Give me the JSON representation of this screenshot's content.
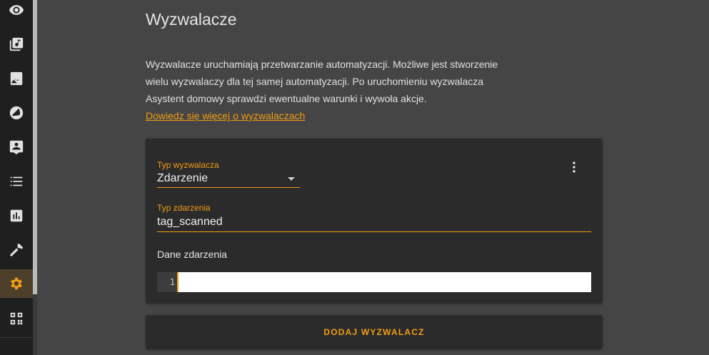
{
  "sidebar": {
    "items": [
      {
        "icon": "eye-icon",
        "active": false
      },
      {
        "icon": "media-library-icon",
        "active": false
      },
      {
        "icon": "image-search-icon",
        "active": false
      },
      {
        "icon": "no-entry-icon",
        "active": false
      },
      {
        "icon": "account-message-icon",
        "active": false
      },
      {
        "icon": "list-icon",
        "active": false
      },
      {
        "icon": "bar-chart-icon",
        "active": false
      },
      {
        "icon": "hammer-icon",
        "active": false
      },
      {
        "icon": "gear-icon",
        "active": true
      },
      {
        "icon": "qr-code-icon",
        "active": false
      }
    ],
    "active_color": "#f39c12"
  },
  "page": {
    "title": "Wyzwalacze",
    "intro_line1": "Wyzwalacze uruchamiają przetwarzanie automatyzacji. Możliwe jest stworzenie",
    "intro_line2": "wielu wyzwalaczy dla tej samej automatyzacji. Po uruchomieniu wyzwalacza",
    "intro_line3": "Asystent domowy sprawdzi ewentualne warunki i wywoła akcje.",
    "learn_more_link": "Dowiedz się więcej o wyzwalaczach"
  },
  "trigger_card": {
    "type_label": "Typ wyzwalacza",
    "type_value": "Zdarzenie",
    "event_type_label": "Typ zdarzenia",
    "event_type_value": "tag_scanned",
    "event_data_label": "Dane zdarzenia",
    "editor_line_number": "1",
    "menu_icon": "more-vertical-icon"
  },
  "add_button_label": "DODAJ WYZWALACZ",
  "colors": {
    "accent": "#f39c12",
    "background": "#454545",
    "card": "#2b2b2b",
    "sidebar": "#1f1f1f"
  }
}
